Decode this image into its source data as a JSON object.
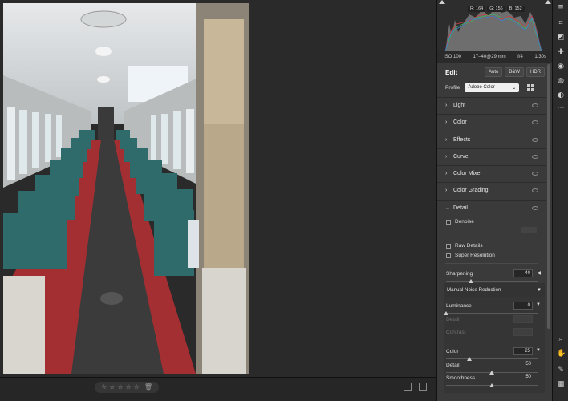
{
  "histogram": {
    "r": "R: 164",
    "g": "G: 156",
    "b": "B: 152"
  },
  "exif": {
    "iso": "ISO 100",
    "focal": "17–40@29 mm",
    "aperture": "f/4",
    "shutter": "1/30s"
  },
  "edit": {
    "title": "Edit",
    "auto": "Auto",
    "bw": "B&W",
    "hdr": "HDR"
  },
  "profile": {
    "label": "Profile",
    "value": "Adobe Color"
  },
  "sections": [
    {
      "label": "Light",
      "expanded": false
    },
    {
      "label": "Color",
      "expanded": false
    },
    {
      "label": "Effects",
      "expanded": false
    },
    {
      "label": "Curve",
      "expanded": false
    },
    {
      "label": "Color Mixer",
      "expanded": false
    },
    {
      "label": "Color Grading",
      "expanded": false
    },
    {
      "label": "Detail",
      "expanded": true
    }
  ],
  "detail": {
    "denoise": "Denoise",
    "raw_details": "Raw Details",
    "super_resolution": "Super Resolution",
    "sharpening": {
      "label": "Sharpening",
      "value": "40",
      "fraction": 0.27
    },
    "nr_header": "Manual Noise Reduction",
    "luminance": {
      "label": "Luminance",
      "value": "0",
      "fraction": 0.0
    },
    "lum_detail": {
      "label": "Detail",
      "value": ""
    },
    "lum_contrast": {
      "label": "Contrast",
      "value": ""
    },
    "color": {
      "label": "Color",
      "value": "25",
      "fraction": 0.25
    },
    "color_detail": {
      "label": "Detail",
      "value": "50",
      "fraction": 0.5
    },
    "smoothness": {
      "label": "Smoothness",
      "value": "50",
      "fraction": 0.5
    }
  },
  "rating": {
    "stars": 0,
    "max": 5
  },
  "colors": {
    "panel_bg": "#3a3a3a",
    "canvas_bg": "#2a2a2a",
    "seat_teal": "#2f6b6a",
    "carpet_red": "#a32f33"
  },
  "icons": [
    "sliders-icon",
    "crop-icon",
    "eraser-icon",
    "healing-icon",
    "red-eye-icon",
    "masking-icon",
    "presets-icon",
    "more-icon",
    "zoom-icon",
    "hand-icon",
    "color-sampler-icon",
    "grid-overlay-icon"
  ]
}
